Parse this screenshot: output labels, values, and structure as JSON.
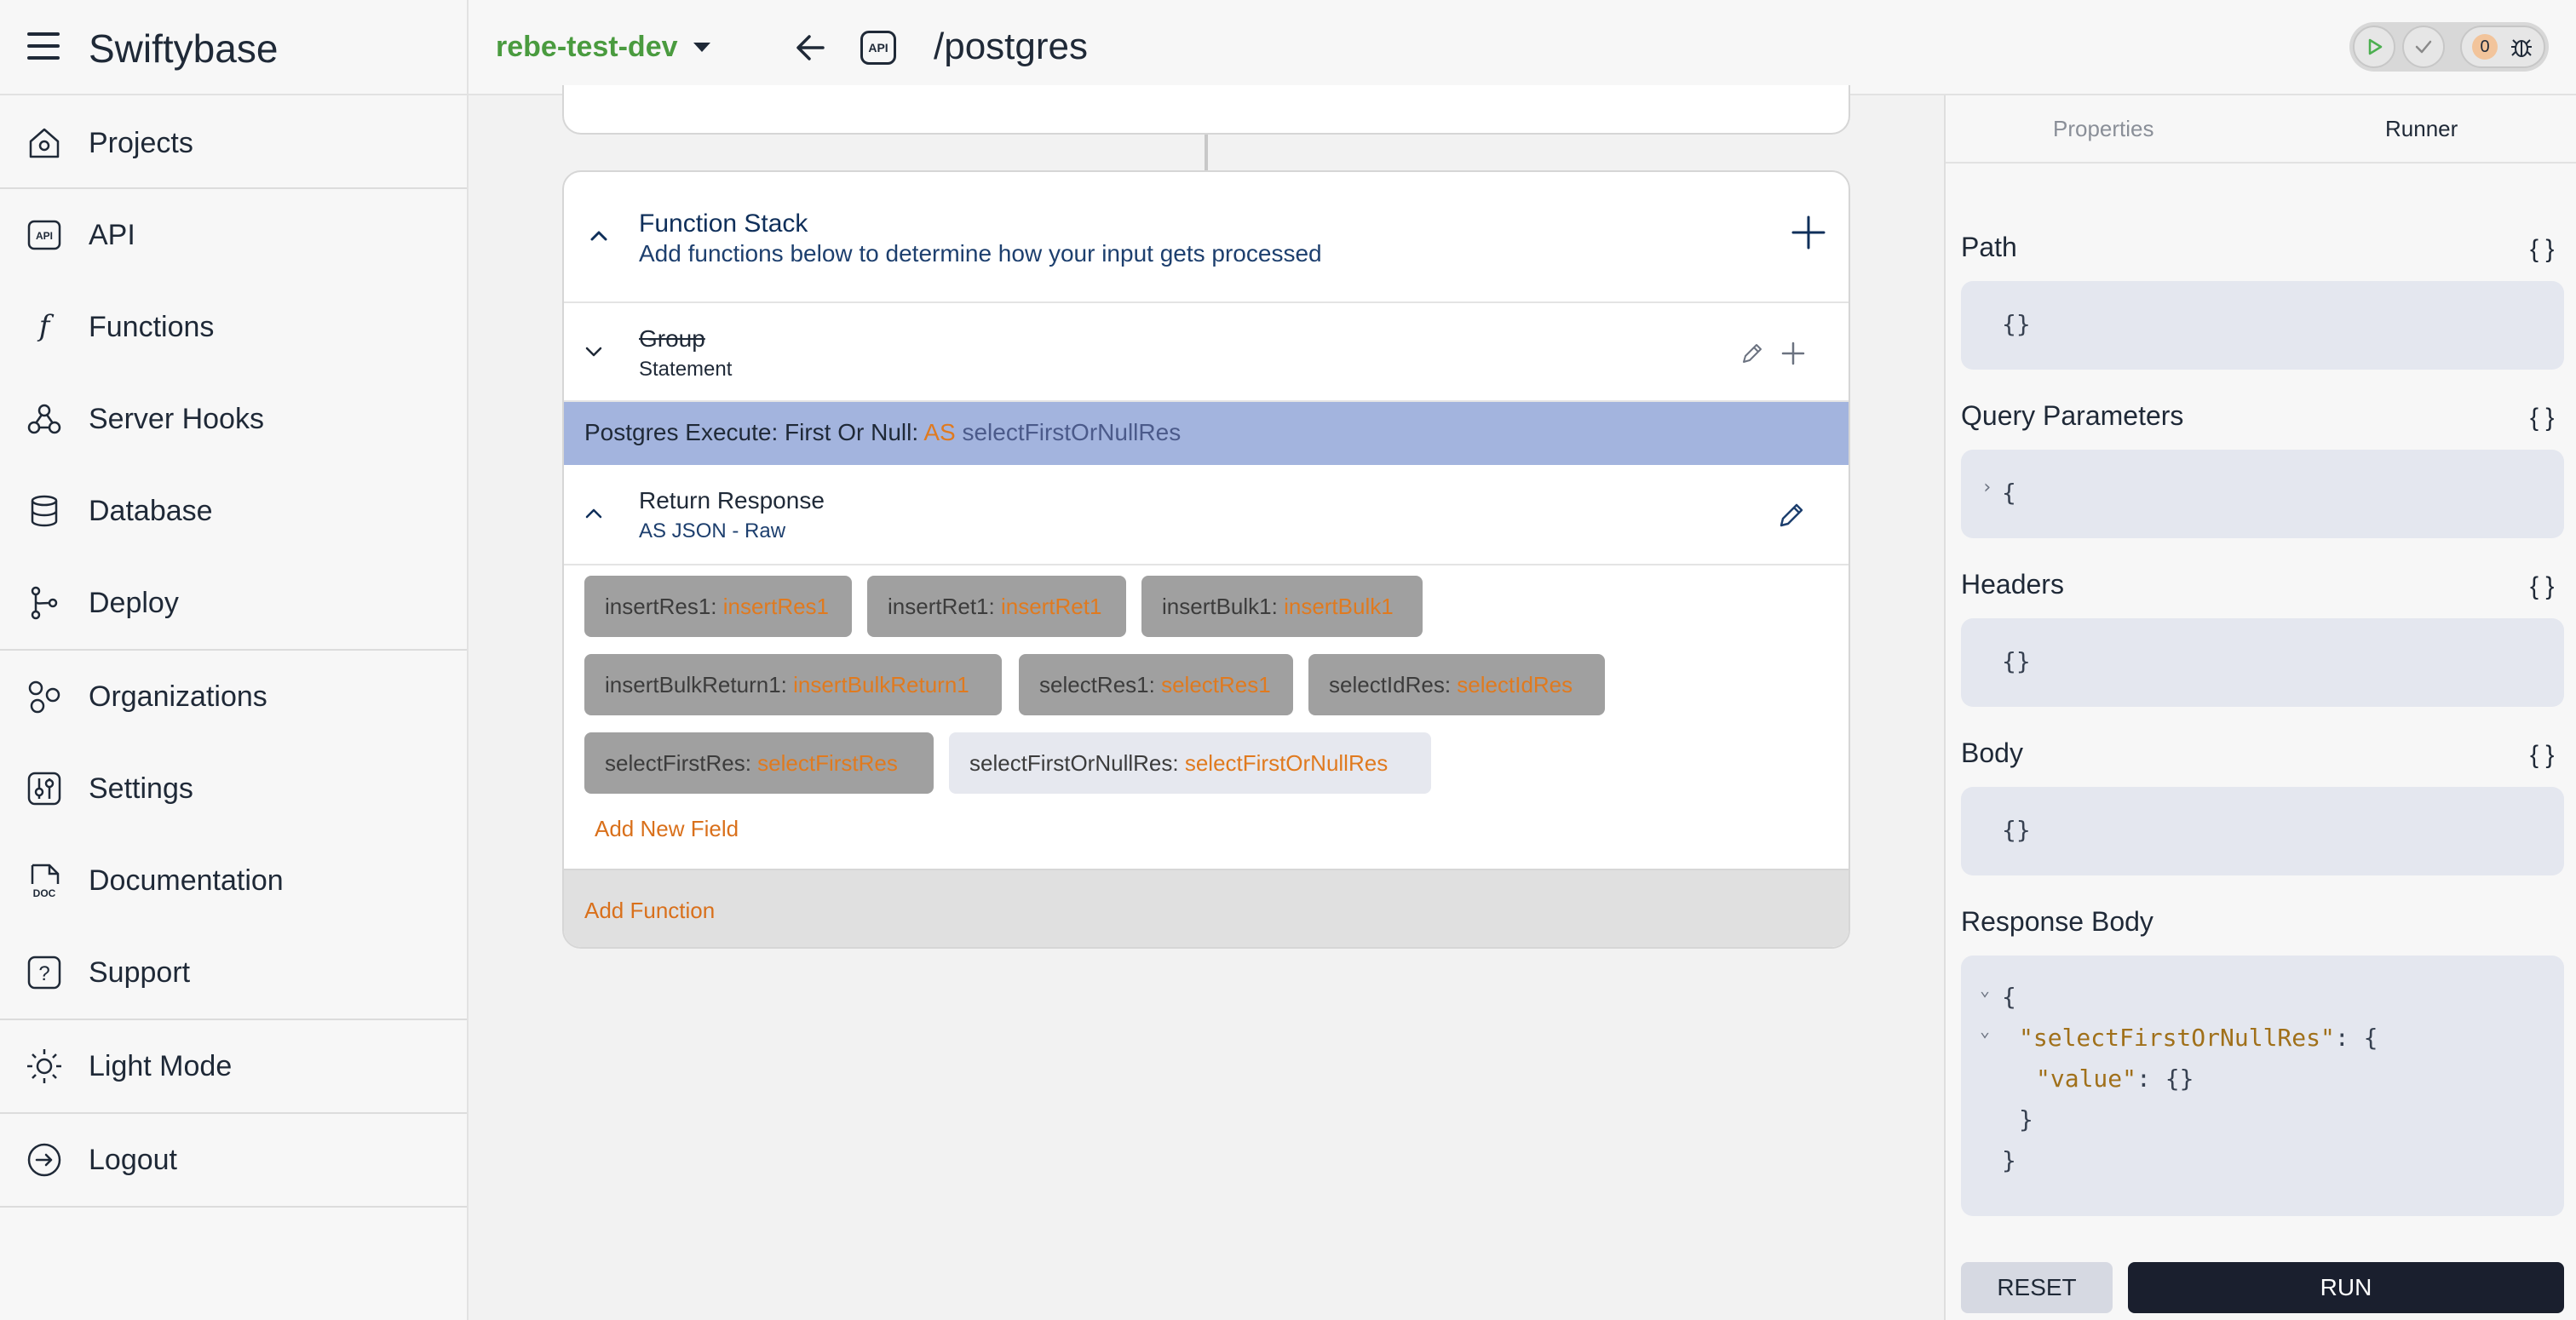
{
  "app": {
    "title": "Swiftybase"
  },
  "header": {
    "project": "rebe-test-dev",
    "api_badge": "API",
    "route": "/postgres",
    "error_count": "0"
  },
  "sidebar": {
    "items": [
      {
        "label": "Projects",
        "icon": "home-icon"
      },
      {
        "label": "API",
        "icon": "api-icon"
      },
      {
        "label": "Functions",
        "icon": "function-icon"
      },
      {
        "label": "Server Hooks",
        "icon": "webhook-icon"
      },
      {
        "label": "Database",
        "icon": "database-icon"
      },
      {
        "label": "Deploy",
        "icon": "git-branch-icon"
      },
      {
        "label": "Organizations",
        "icon": "organizations-icon"
      },
      {
        "label": "Settings",
        "icon": "settings-icon"
      },
      {
        "label": "Documentation",
        "icon": "doc-icon"
      },
      {
        "label": "Support",
        "icon": "help-icon"
      },
      {
        "label": "Light Mode",
        "icon": "sun-icon"
      },
      {
        "label": "Logout",
        "icon": "logout-icon"
      }
    ]
  },
  "function_stack": {
    "title": "Function Stack",
    "subtitle": "Add functions below to determine how your input gets processed",
    "group": {
      "title": "Group",
      "subtitle": "Statement"
    },
    "postgres": {
      "prefix": "Postgres Execute: First Or Null:",
      "as": "AS",
      "var": "selectFirstOrNullRes"
    },
    "return_response": {
      "title": "Return Response",
      "subtitle": "AS JSON - Raw"
    },
    "fields": [
      {
        "key": "insertRes1",
        "value": "insertRes1"
      },
      {
        "key": "insertRet1",
        "value": "insertRet1"
      },
      {
        "key": "insertBulk1",
        "value": "insertBulk1"
      },
      {
        "key": "insertBulkReturn1",
        "value": "insertBulkReturn1"
      },
      {
        "key": "selectRes1",
        "value": "selectRes1"
      },
      {
        "key": "selectIdRes",
        "value": "selectIdRes"
      },
      {
        "key": "selectFirstRes",
        "value": "selectFirstRes"
      },
      {
        "key": "selectFirstOrNullRes",
        "value": "selectFirstOrNullRes"
      }
    ],
    "add_field": "Add New Field",
    "add_function": "Add Function"
  },
  "runner": {
    "tabs": [
      "Properties",
      "Runner"
    ],
    "active_tab": "Runner",
    "path_label": "Path",
    "path_value": "{}",
    "query_label": "Query Parameters",
    "query_value": "{",
    "headers_label": "Headers",
    "headers_value": "{}",
    "body_label": "Body",
    "body_value": "{}",
    "braces": "{ }",
    "response_label": "Response Body",
    "response": {
      "open": "{",
      "key1": "\"selectFirstOrNullRes\"",
      "colon_open": ": {",
      "key2": "\"value\"",
      "val2": ": {}",
      "close_inner": "}",
      "close": "}"
    },
    "reset": "RESET",
    "run": "RUN"
  },
  "colors": {
    "accent_orange": "#e07a1f",
    "project_green": "#4a9b3f",
    "highlight": "#a3b4de"
  }
}
